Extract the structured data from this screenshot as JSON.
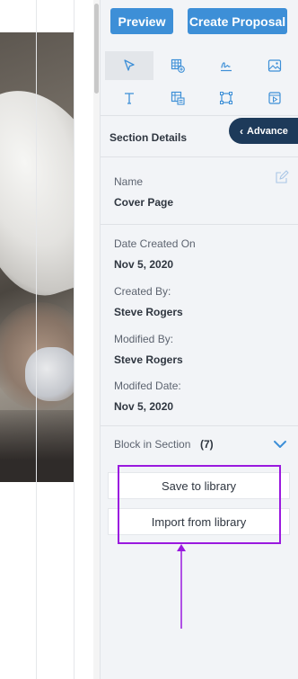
{
  "toolbar": {
    "preview_label": "Preview",
    "create_label": "Create Proposal"
  },
  "tools": [
    {
      "name": "select-tool",
      "icon": "cursor-arrow-icon"
    },
    {
      "name": "table-tool",
      "icon": "table-add-icon"
    },
    {
      "name": "signature-tool",
      "icon": "signature-icon"
    },
    {
      "name": "image-tool",
      "icon": "image-icon"
    },
    {
      "name": "text-tool",
      "icon": "text-icon"
    },
    {
      "name": "pricing-tool",
      "icon": "pricing-table-icon"
    },
    {
      "name": "shape-tool",
      "icon": "shape-square-icon"
    },
    {
      "name": "video-tool",
      "icon": "video-icon"
    }
  ],
  "section": {
    "title": "Section Details",
    "advance_label": "Advance",
    "name_label": "Name",
    "name_value": "Cover Page",
    "date_created_label": "Date Created On",
    "date_created_value": "Nov 5, 2020",
    "created_by_label": "Created By:",
    "created_by_value": "Steve Rogers",
    "modified_by_label": "Modified By:",
    "modified_by_value": "Steve Rogers",
    "modified_date_label": "Modifed Date:",
    "modified_date_value": "Nov 5, 2020",
    "block_label": "Block in Section",
    "block_count": "(7)"
  },
  "library": {
    "save_label": "Save to library",
    "import_label": "Import from library"
  },
  "colors": {
    "primary_button": "#3d8fd7",
    "advance_button": "#1d3a5a",
    "highlight": "#9a19df",
    "panel_background": "#f2f4f7"
  }
}
